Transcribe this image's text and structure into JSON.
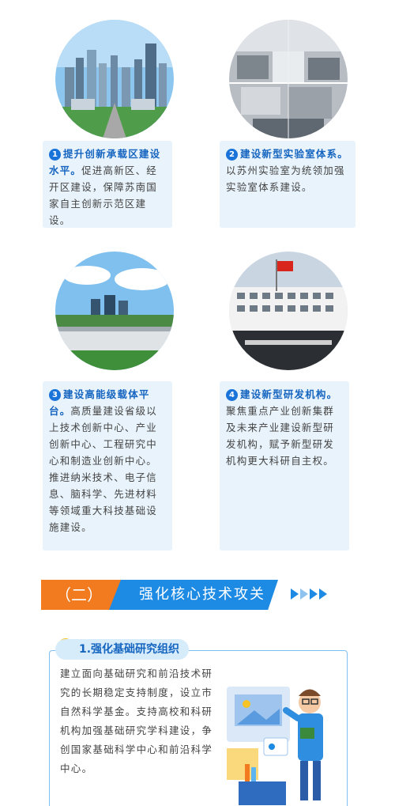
{
  "items": [
    {
      "num": "1",
      "head": "提升创新承载区建设水平。",
      "body": "促进高新区、经开区建设，保障苏南国家自主创新示范区建设。",
      "photo": "city-skyline"
    },
    {
      "num": "2",
      "head": "建设新型实验室体系。",
      "body": "以苏州实验室为统领加强实验室体系建设。",
      "photo": "laboratory"
    },
    {
      "num": "3",
      "head": "建设高能级载体平台。",
      "body": "高质量建设省级以上技术创新中心、产业创新中心、工程研究中心和制造业创新中心。推进纳米技术、电子信息、脑科学、先进材料等领域重大科技基础设施建设。",
      "photo": "industrial-park"
    },
    {
      "num": "4",
      "head": "建设新型研发机构。",
      "body": "聚焦重点产业创新集群及未来产业建设新型研发机构，赋予新型研发机构更大科研自主权。",
      "photo": "research-institute"
    }
  ],
  "section": {
    "index": "（二）",
    "title": "强化核心技术攻关"
  },
  "subsection": {
    "label": "1.强化基础研究组织",
    "text": "建立面向基础研究和前沿技术研究的长期稳定支持制度，设立市自然科学基金。支持高校和科研机构加强基础研究学科建设，争创国家基础科学中心和前沿科学中心。",
    "illustration": "researcher-illustration"
  },
  "colors": {
    "accent_blue": "#1d8ae4",
    "accent_orange": "#f27a1f",
    "card_bg": "#e8f3fb"
  }
}
